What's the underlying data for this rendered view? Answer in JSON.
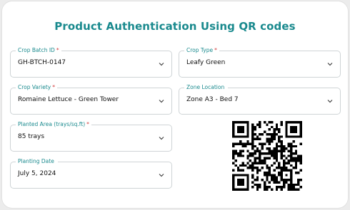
{
  "title": "Product Authentication Using QR codes",
  "fields": [
    {
      "label": "Crop Batch ID",
      "required": "*",
      "value": "GH-BTCH-0147"
    },
    {
      "label": "Crop Type",
      "required": "*",
      "value": "Leafy Green"
    },
    {
      "label": "Crop Variety",
      "required": "*",
      "value": "Romaine Lettuce - Green Tower"
    },
    {
      "label": "Zone Location",
      "required": "",
      "value": "Zone A3 - Bed 7"
    },
    {
      "label": "Planted Area (trays/sq.ft)",
      "required": "*",
      "value": "85 trays"
    },
    {
      "label": "Planting Date",
      "required": "",
      "value": "July 5, 2024"
    }
  ],
  "icons": {
    "dropdown": "chevron-down-icon",
    "qr": "qr-code"
  },
  "colors": {
    "accent": "#1a8a8e",
    "required": "#d23b3b",
    "border": "#cfd4d6"
  }
}
